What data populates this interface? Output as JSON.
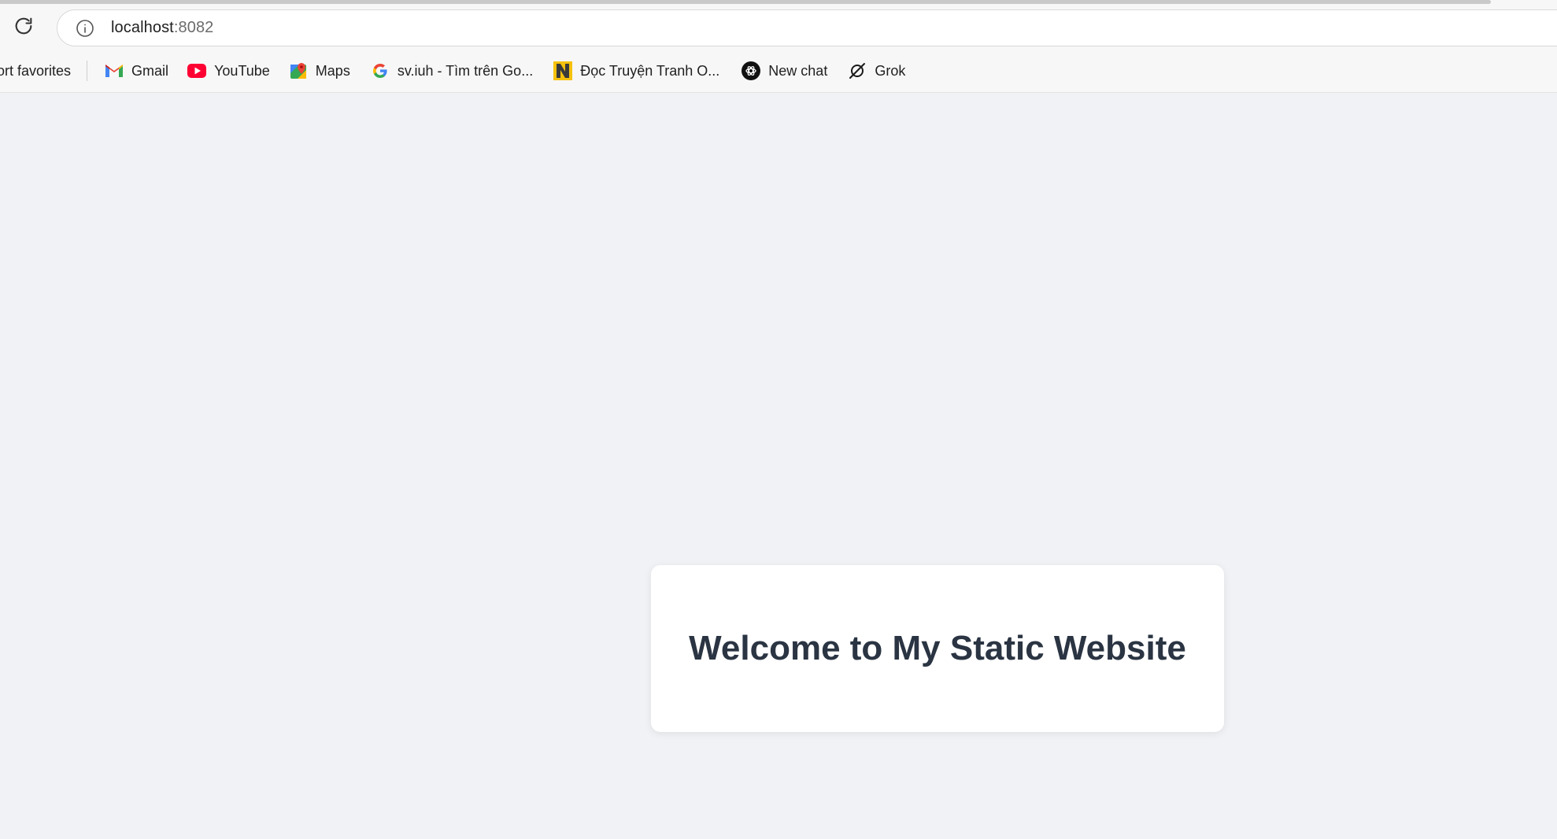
{
  "browser": {
    "url_host": "localhost",
    "url_port": ":8082"
  },
  "bookmarks": {
    "import_label": "ort favorites",
    "items": [
      {
        "label": "Gmail",
        "icon": "gmail-icon"
      },
      {
        "label": "YouTube",
        "icon": "youtube-icon"
      },
      {
        "label": "Maps",
        "icon": "maps-icon"
      },
      {
        "label": "sv.iuh - Tìm trên Go...",
        "icon": "google-icon"
      },
      {
        "label": "Đọc Truyện Tranh O...",
        "icon": "n-logo-icon"
      },
      {
        "label": "New chat",
        "icon": "chatgpt-icon"
      },
      {
        "label": "Grok",
        "icon": "grok-icon"
      }
    ]
  },
  "page": {
    "heading": "Welcome to My Static Website"
  },
  "colors": {
    "page_background": "#f0f2f5",
    "card_background": "#ffffff",
    "heading_color": "#2a3442",
    "youtube_red": "#ff0033"
  }
}
